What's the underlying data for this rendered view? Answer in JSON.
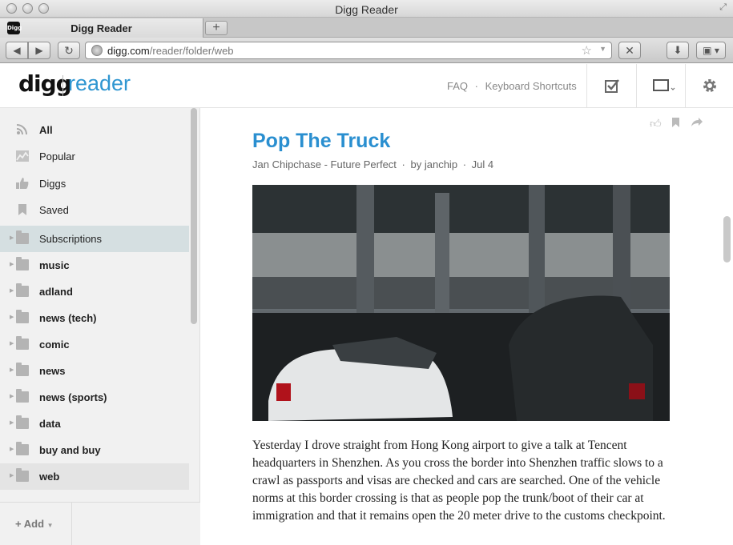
{
  "window": {
    "title": "Digg Reader"
  },
  "tabs": [
    {
      "label": "Digg Reader",
      "favicon_text": "Digg"
    }
  ],
  "toolbar": {
    "url_host": "digg.com",
    "url_path": "/reader/folder/web",
    "icons": [
      "back-icon",
      "forward-icon",
      "reload-icon",
      "globe-icon",
      "star-icon",
      "stop-icon",
      "download-icon",
      "bookmark-icon"
    ]
  },
  "app": {
    "logo_left": "digg",
    "logo_right": "reader",
    "faq": "FAQ",
    "separator": "·",
    "shortcuts": "Keyboard Shortcuts"
  },
  "sidebar": {
    "items": [
      {
        "label": "All",
        "icon": "rss-icon",
        "bold": true
      },
      {
        "label": "Popular",
        "icon": "chart-icon",
        "bold": false
      },
      {
        "label": "Diggs",
        "icon": "thumbs-up-icon",
        "bold": false
      },
      {
        "label": "Saved",
        "icon": "bookmark-icon",
        "bold": false
      },
      {
        "label": "Subscriptions",
        "icon": "folder-icon",
        "bold": false
      },
      {
        "label": "music",
        "icon": "folder-icon",
        "bold": true
      },
      {
        "label": "adland",
        "icon": "folder-icon",
        "bold": true
      },
      {
        "label": "news (tech)",
        "icon": "folder-icon",
        "bold": true
      },
      {
        "label": "comic",
        "icon": "folder-icon",
        "bold": true
      },
      {
        "label": "news",
        "icon": "folder-icon",
        "bold": true
      },
      {
        "label": "news (sports)",
        "icon": "folder-icon",
        "bold": true
      },
      {
        "label": "data",
        "icon": "folder-icon",
        "bold": true
      },
      {
        "label": "buy and buy",
        "icon": "folder-icon",
        "bold": true
      },
      {
        "label": "web",
        "icon": "folder-icon",
        "bold": true
      }
    ],
    "add_label": "Add"
  },
  "article": {
    "title": "Pop The Truck",
    "source": "Jan Chipchase - Future Perfect",
    "author": "by janchip",
    "date": "Jul 4",
    "meta_separator": "·",
    "body": "Yesterday I drove straight from Hong Kong airport to give a talk at Tencent headquarters in Shenzhen. As you cross the border into Shenzhen traffic slows to a crawl as passports and visas are checked and cars are searched. One of the vehicle norms at this border crossing is that as people pop the trunk/boot of their car at immigration and that it remains open the 20 meter drive to the customs checkpoint."
  }
}
